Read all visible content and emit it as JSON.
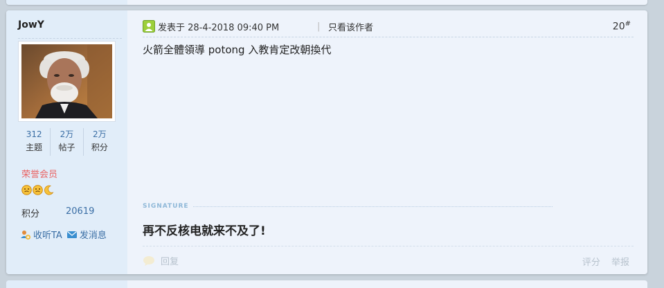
{
  "author": {
    "username": "JowY",
    "stats": [
      {
        "value": "312",
        "label": "主题"
      },
      {
        "value": "2万",
        "label": "帖子"
      },
      {
        "value": "2万",
        "label": "积分"
      }
    ],
    "group": "荣誉会员",
    "medals": [
      "smiley-medal-icon",
      "smiley-medal-icon",
      "moon-medal-icon"
    ],
    "credits_label": "积分",
    "credits_value": "20619",
    "follow_label": "收听TA",
    "message_label": "发消息"
  },
  "post": {
    "posted_at": "发表于 28-4-2018 09:40 PM",
    "divider": "|",
    "author_only": "只看该作者",
    "floor": "20",
    "floor_mark": "#",
    "message": "火箭全體領導 potong 入教肯定改朝換代",
    "signature_label": "SIGNATURE",
    "signature": "再不反核电就来不及了!",
    "reply_label": "回复",
    "rate_label": "评分",
    "report_label": "举报"
  },
  "colors": {
    "page_bg": "#c9d3dc",
    "post_bg": "#eef3fb",
    "sidebar_bg": "#e1edf9",
    "link_blue": "#3a6ea5",
    "group_red": "#e96565",
    "muted": "#b7c2cd"
  }
}
